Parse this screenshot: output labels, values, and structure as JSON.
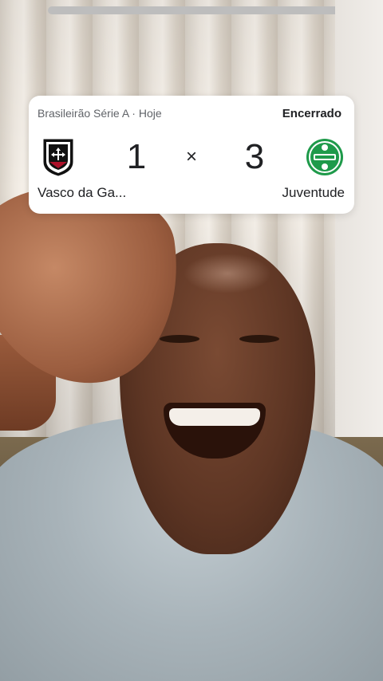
{
  "scorecard": {
    "competition": "Brasileirão Série A · Hoje",
    "status": "Encerrado",
    "home": {
      "name": "Vasco da Ga...",
      "score": "1",
      "crest_icon": "vasco-crest-icon"
    },
    "away": {
      "name": "Juventude",
      "score": "3",
      "crest_icon": "juventude-crest-icon"
    },
    "separator": "×"
  },
  "colors": {
    "card_bg": "#ffffff",
    "text_primary": "#202124",
    "text_secondary": "#606368",
    "juventude_green": "#1e9a4a"
  }
}
